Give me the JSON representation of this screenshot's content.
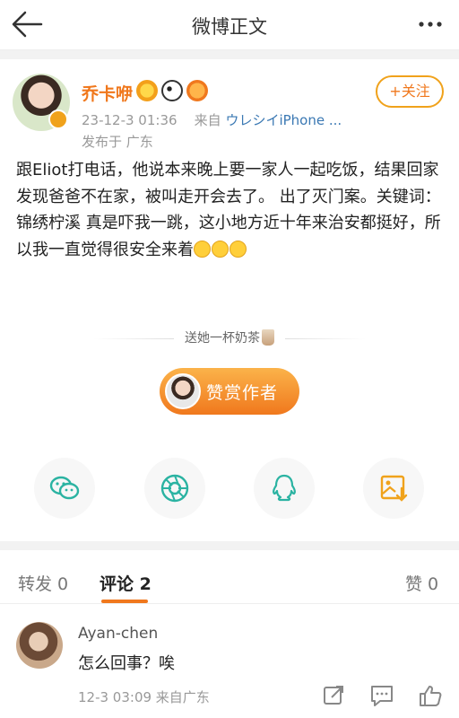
{
  "nav": {
    "title": "微博正文"
  },
  "post": {
    "username": "乔卡咿",
    "timestamp": "23-12-3 01:36",
    "source_prefix": "来自",
    "source": "ウレシイiPhone ...",
    "location": "发布于 广东",
    "follow_label": "+关注",
    "content": "跟Eliot打电话，他说本来晚上要一家人一起吃饭，结果回家发现爸爸不在家，被叫走开会去了。 出了灭门案。关键词：锦绣柠溪  真是吓我一跳，这小地方近十年来治安都挺好，所以我一直觉得很安全来着",
    "emoji_count": 3,
    "emoji": "grimace-face-emoji"
  },
  "tip": {
    "prompt": "送她一杯奶茶",
    "button_label": "赞赏作者"
  },
  "share": [
    {
      "name": "wechat-icon"
    },
    {
      "name": "moments-icon"
    },
    {
      "name": "qq-icon"
    },
    {
      "name": "save-image-icon"
    }
  ],
  "tabs": {
    "repost": "转发 0",
    "comment": "评论 2",
    "like": "赞 0",
    "active": "comment"
  },
  "comment": {
    "user": "Ayan-chen",
    "text": "怎么回事？唉",
    "meta": "12-3 03:09  来自广东"
  },
  "colors": {
    "accent": "#f0781d",
    "link": "#3a78b3",
    "icon_teal": "#2bb3a2"
  }
}
